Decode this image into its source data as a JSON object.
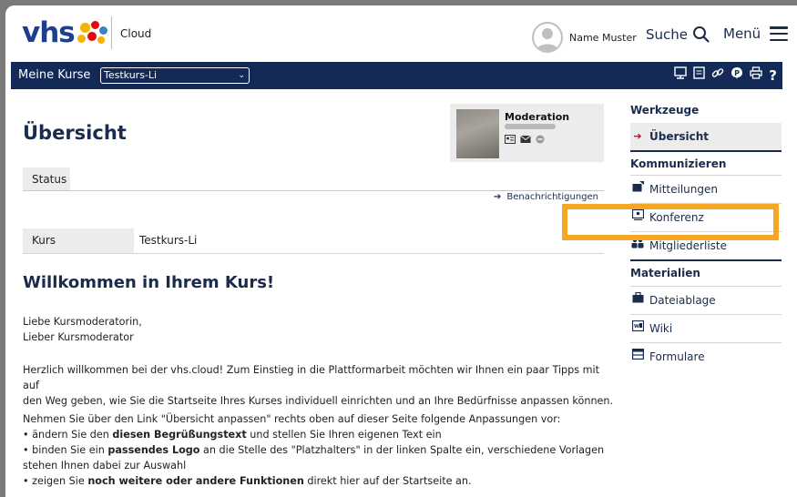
{
  "header": {
    "logo_text": "vhs",
    "product_label": "Cloud",
    "user_name": "Name Muster",
    "search_label": "Suche",
    "menu_label": "Menü"
  },
  "navbar": {
    "my_courses_label": "Meine Kurse",
    "selected_course": "Testkurs-Li",
    "tool_icons": [
      "network-icon",
      "document-icon",
      "link-icon",
      "info-icon",
      "print-icon",
      "help-icon"
    ]
  },
  "moderation": {
    "title": "Moderation"
  },
  "main": {
    "page_title": "Übersicht",
    "tab_status": "Status",
    "notifications_link": "Benachrichtigungen",
    "course_key": "Kurs",
    "course_value": "Testkurs-Li",
    "welcome_heading": "Willkommen in Ihrem Kurs!",
    "greeting_1": "Liebe Kursmoderatorin,",
    "greeting_2": "Lieber Kursmoderator",
    "intro_1": "Herzlich willkommen bei der vhs.cloud! Zum Einstieg in die Plattformarbeit möchten wir Ihnen ein paar Tipps mit auf",
    "intro_2": "den Weg geben, wie Sie die Startseite Ihres Kurses individuell einrichten und an Ihre Bedürfnisse anpassen können.",
    "steps_intro": "Nehmen Sie über den Link \"Übersicht anpassen\" rechts oben auf dieser Seite folgende Anpassungen vor:",
    "step1_a": "• ändern Sie den ",
    "step1_b": "diesen Begrüßungstext",
    "step1_c": " und stellen Sie Ihren eigenen Text ein",
    "step2_a": "• binden Sie ein ",
    "step2_b": "passendes Logo",
    "step2_c": " an die Stelle des \"Platzhalters\" in der linken Spalte ein, verschiedene Vorlagen",
    "step2_d": "stehen Ihnen dabei zur Auswahl",
    "step3_a": "• zeigen Sie ",
    "step3_b": "noch weitere oder andere Funktionen",
    "step3_c": " direkt hier auf der Startseite an."
  },
  "sidebar": {
    "section_tools": "Werkzeuge",
    "item_overview": "Übersicht",
    "section_communicate": "Kommunizieren",
    "item_messages": "Mitteilungen",
    "item_conference": "Konferenz",
    "item_members": "Mitgliederliste",
    "section_materials": "Materialien",
    "item_files": "Dateiablage",
    "item_wiki": "Wiki",
    "item_forms": "Formulare"
  },
  "colors": {
    "navy": "#132a57",
    "highlight": "#f5a623",
    "active_marker": "#d0021b"
  }
}
